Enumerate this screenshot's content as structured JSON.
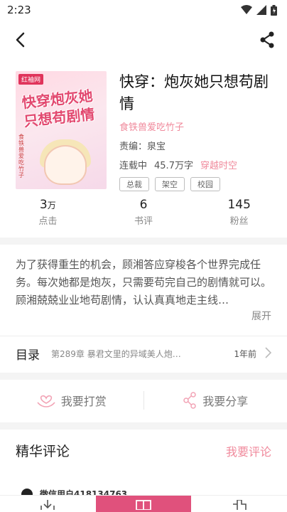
{
  "status_bar": {
    "time": "2:23"
  },
  "book": {
    "cover": {
      "badge": "红袖网",
      "title": "快穿炮灰她只想苟剧情",
      "author": "食铁兽爱吃竹子"
    },
    "title": "快穿：炮灰她只想苟剧情",
    "author": "食铁兽爱吃竹子",
    "editor": "责编：泉宝",
    "status": "连载中",
    "word_count": "45.7万字",
    "genre": "穿越时空",
    "tags": [
      "总裁",
      "架空",
      "校园"
    ]
  },
  "stats": [
    {
      "value": "3",
      "unit": "万",
      "label": "点击"
    },
    {
      "value": "6",
      "unit": "",
      "label": "书评"
    },
    {
      "value": "145",
      "unit": "",
      "label": "粉丝"
    }
  ],
  "synopsis": "为了获得重生的机会，顾湘答应穿梭各个世界完成任务。每次她都是炮灰，只需要苟完自己的剧情就可以。顾湘兢兢业业地苟剧情，认认真真地走主线…",
  "expand_label": "展开",
  "toc": {
    "label": "目录",
    "latest_chapter": "第289章 暴君文里的异域美人炮…",
    "updated": "1年前"
  },
  "actions": {
    "tip_label": "我要打赏",
    "share_label": "我要分享"
  },
  "reviews": {
    "title": "精华评论",
    "write_label": "我要评论",
    "first_user": "微信用户418134763"
  },
  "colors": {
    "accent": "#e0517c",
    "pink_text": "#f08a9c"
  }
}
